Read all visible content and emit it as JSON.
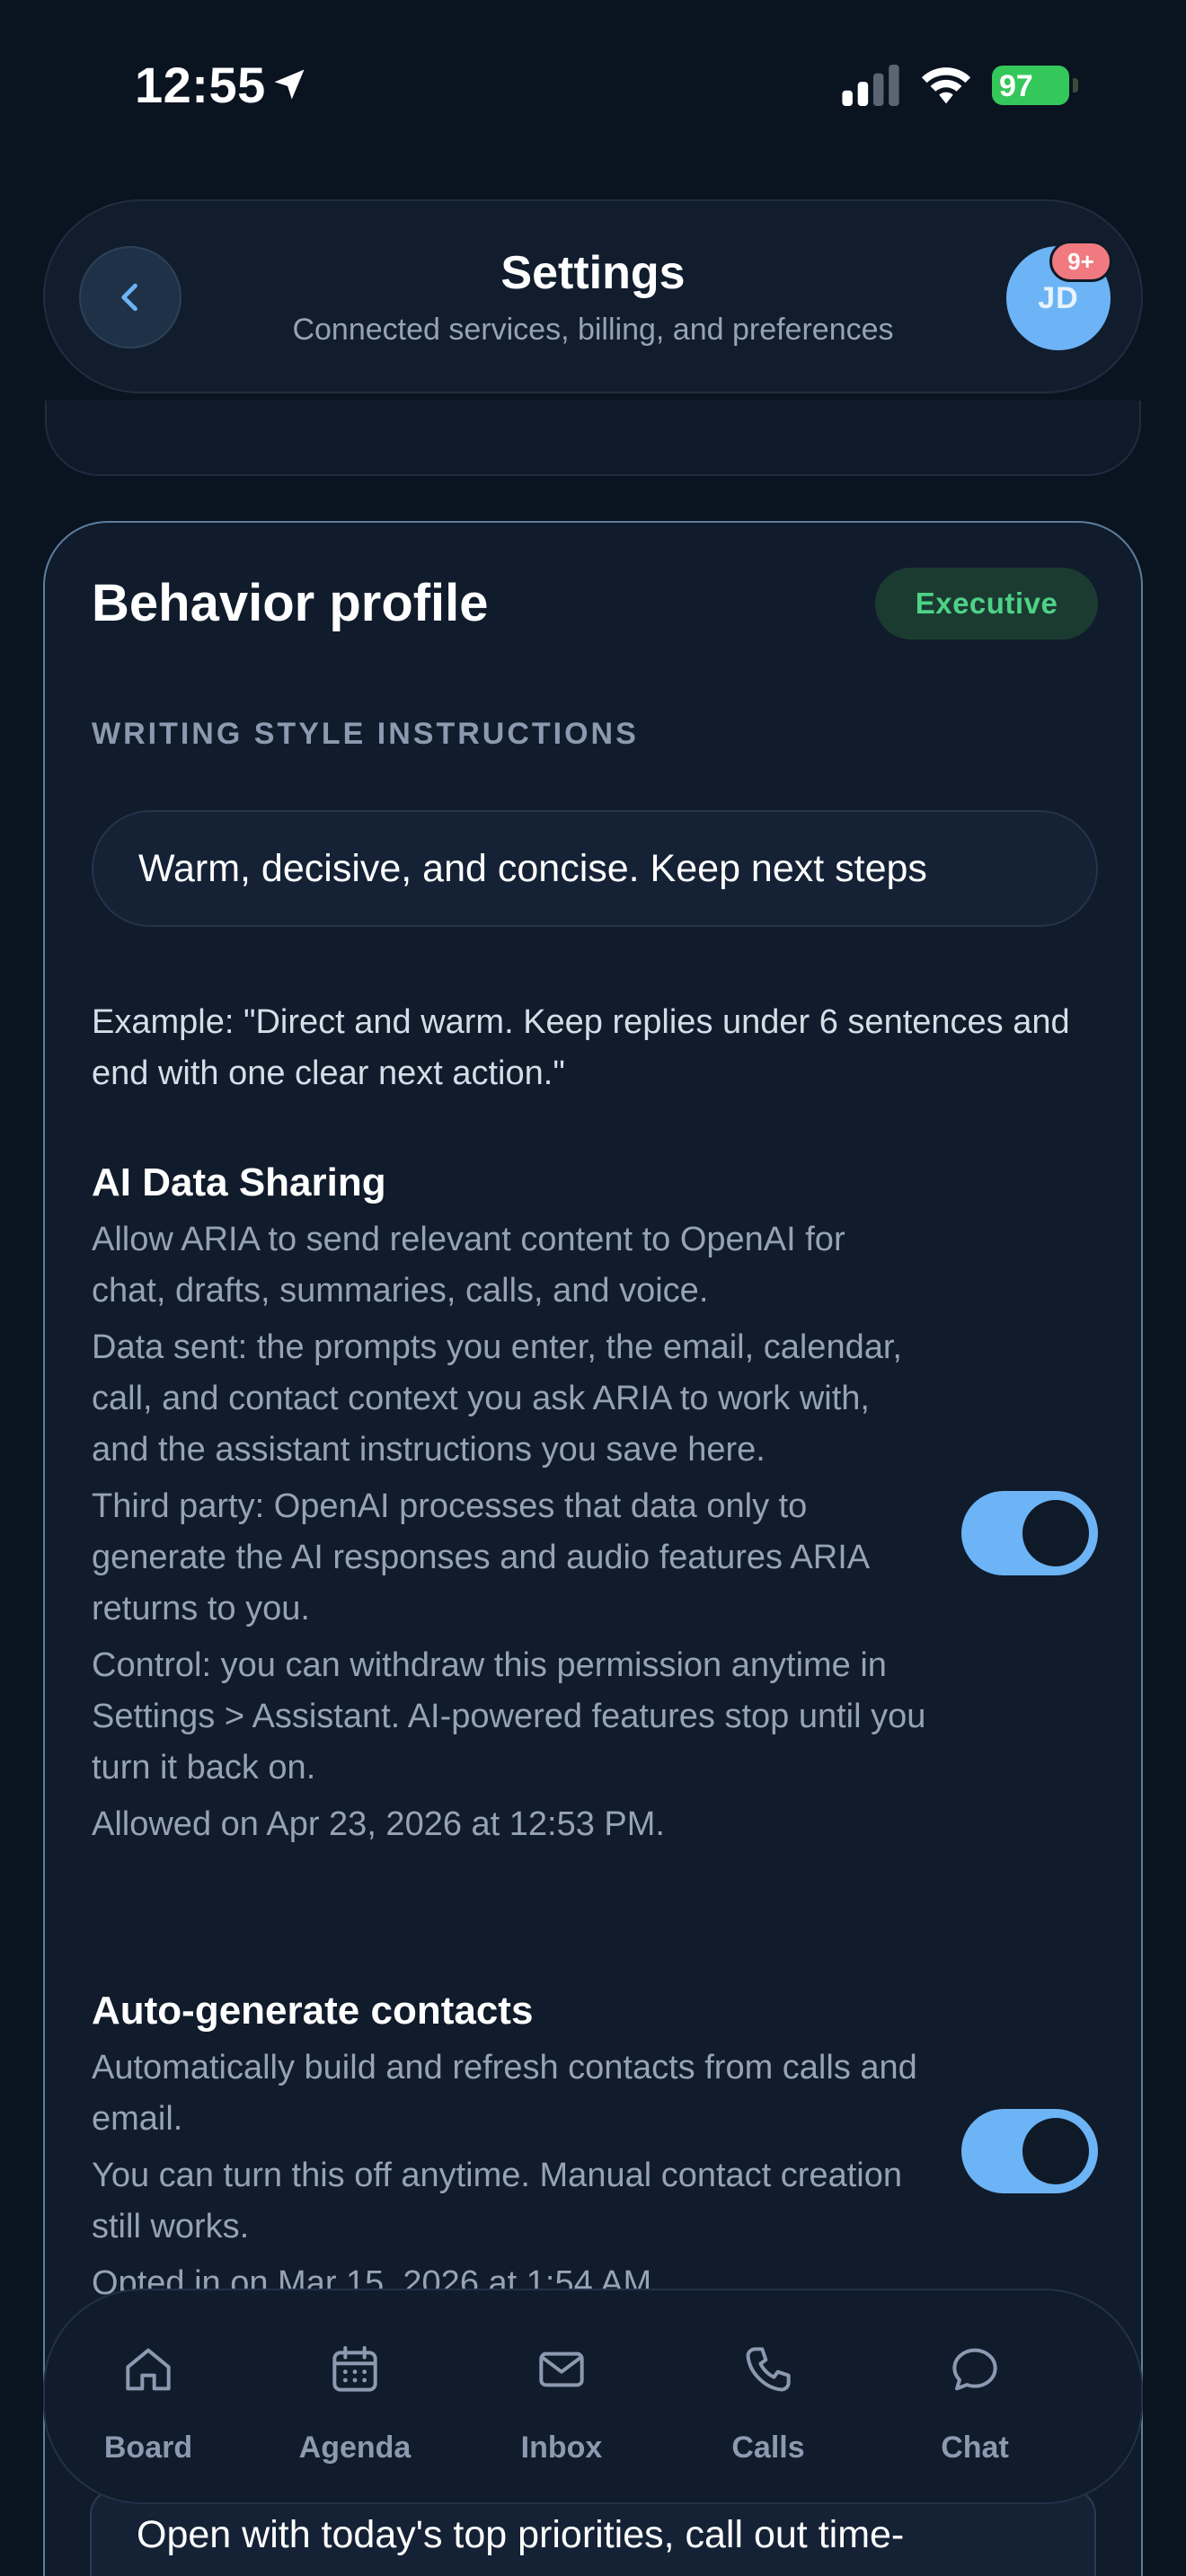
{
  "status_bar": {
    "time": "12:55",
    "battery": "97"
  },
  "header": {
    "title": "Settings",
    "subtitle": "Connected services, billing, and preferences",
    "avatar_initials": "JD",
    "notification_badge": "9+"
  },
  "behavior_profile": {
    "title": "Behavior profile",
    "badge": "Executive",
    "writing_style_label": "WRITING STYLE INSTRUCTIONS",
    "writing_style_value": "Warm, decisive, and concise. Keep next steps",
    "example": "Example: \"Direct and warm. Keep replies under 6 sentences and end with one clear next action.\""
  },
  "ai_data_sharing": {
    "title": "AI Data Sharing",
    "description": "Allow ARIA to send relevant content to OpenAI for chat, drafts, summaries, calls, and voice.",
    "data_sent": "Data sent: the prompts you enter, the email, calendar, call, and contact context you ask ARIA to work with, and the assistant instructions you save here.",
    "third_party": "Third party: OpenAI processes that data only to generate the AI responses and audio features ARIA returns to you.",
    "control": "Control: you can withdraw this permission anytime in Settings > Assistant. AI-powered features stop until you turn it back on.",
    "allowed_on": "Allowed on Apr 23, 2026 at 12:53 PM.",
    "enabled": true
  },
  "auto_contacts": {
    "title": "Auto-generate contacts",
    "description": "Automatically build and refresh contacts from calls and email.",
    "note": "You can turn this off anytime. Manual contact creation still works.",
    "opted_in": "Opted in on Mar 15, 2026 at 1:54 AM.",
    "enabled": true
  },
  "briefing_preview": "Open with today's top priorities, call out time-sensitive follow-ups, and end with the single most",
  "tab_bar": {
    "tabs": [
      {
        "label": "Board",
        "icon": "home-icon"
      },
      {
        "label": "Agenda",
        "icon": "calendar-icon"
      },
      {
        "label": "Inbox",
        "icon": "mail-icon"
      },
      {
        "label": "Calls",
        "icon": "phone-icon"
      },
      {
        "label": "Chat",
        "icon": "chat-bubble-icon"
      }
    ]
  },
  "colors": {
    "background": "#0a1320",
    "card": "#101b2b",
    "accent": "#6cb4f5",
    "badge_green": "#4dd286",
    "notification": "#f07a7f"
  }
}
